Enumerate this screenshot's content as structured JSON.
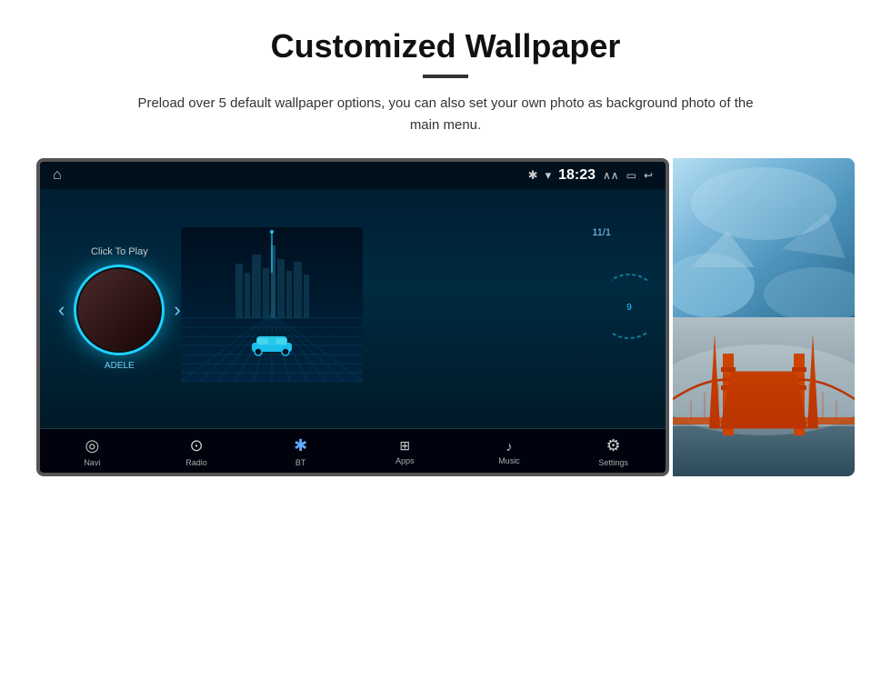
{
  "page": {
    "title": "Customized Wallpaper",
    "subtitle": "Preload over 5 default wallpaper options, you can also set your own photo as background photo of the main menu."
  },
  "car_display": {
    "status_bar": {
      "time": "18:23",
      "bluetooth_icon": "bluetooth",
      "wifi_icon": "wifi",
      "nav_icons": [
        "▲▲",
        "⬜",
        "↩"
      ]
    },
    "media": {
      "click_to_play": "Click To Play",
      "artist": "ADELE",
      "date": "11/1"
    },
    "nav_items": [
      {
        "id": "navi",
        "label": "Navi",
        "icon": "📍"
      },
      {
        "id": "radio",
        "label": "Radio",
        "icon": "📻"
      },
      {
        "id": "bt",
        "label": "BT",
        "icon": "🔵"
      },
      {
        "id": "apps",
        "label": "Apps",
        "icon": "⊞"
      },
      {
        "id": "music",
        "label": "Music",
        "icon": "🎵"
      },
      {
        "id": "settings",
        "label": "Settings",
        "icon": "⚙"
      }
    ]
  },
  "colors": {
    "accent": "#1ecfff",
    "title_color": "#111111",
    "subtitle_color": "#333333"
  }
}
